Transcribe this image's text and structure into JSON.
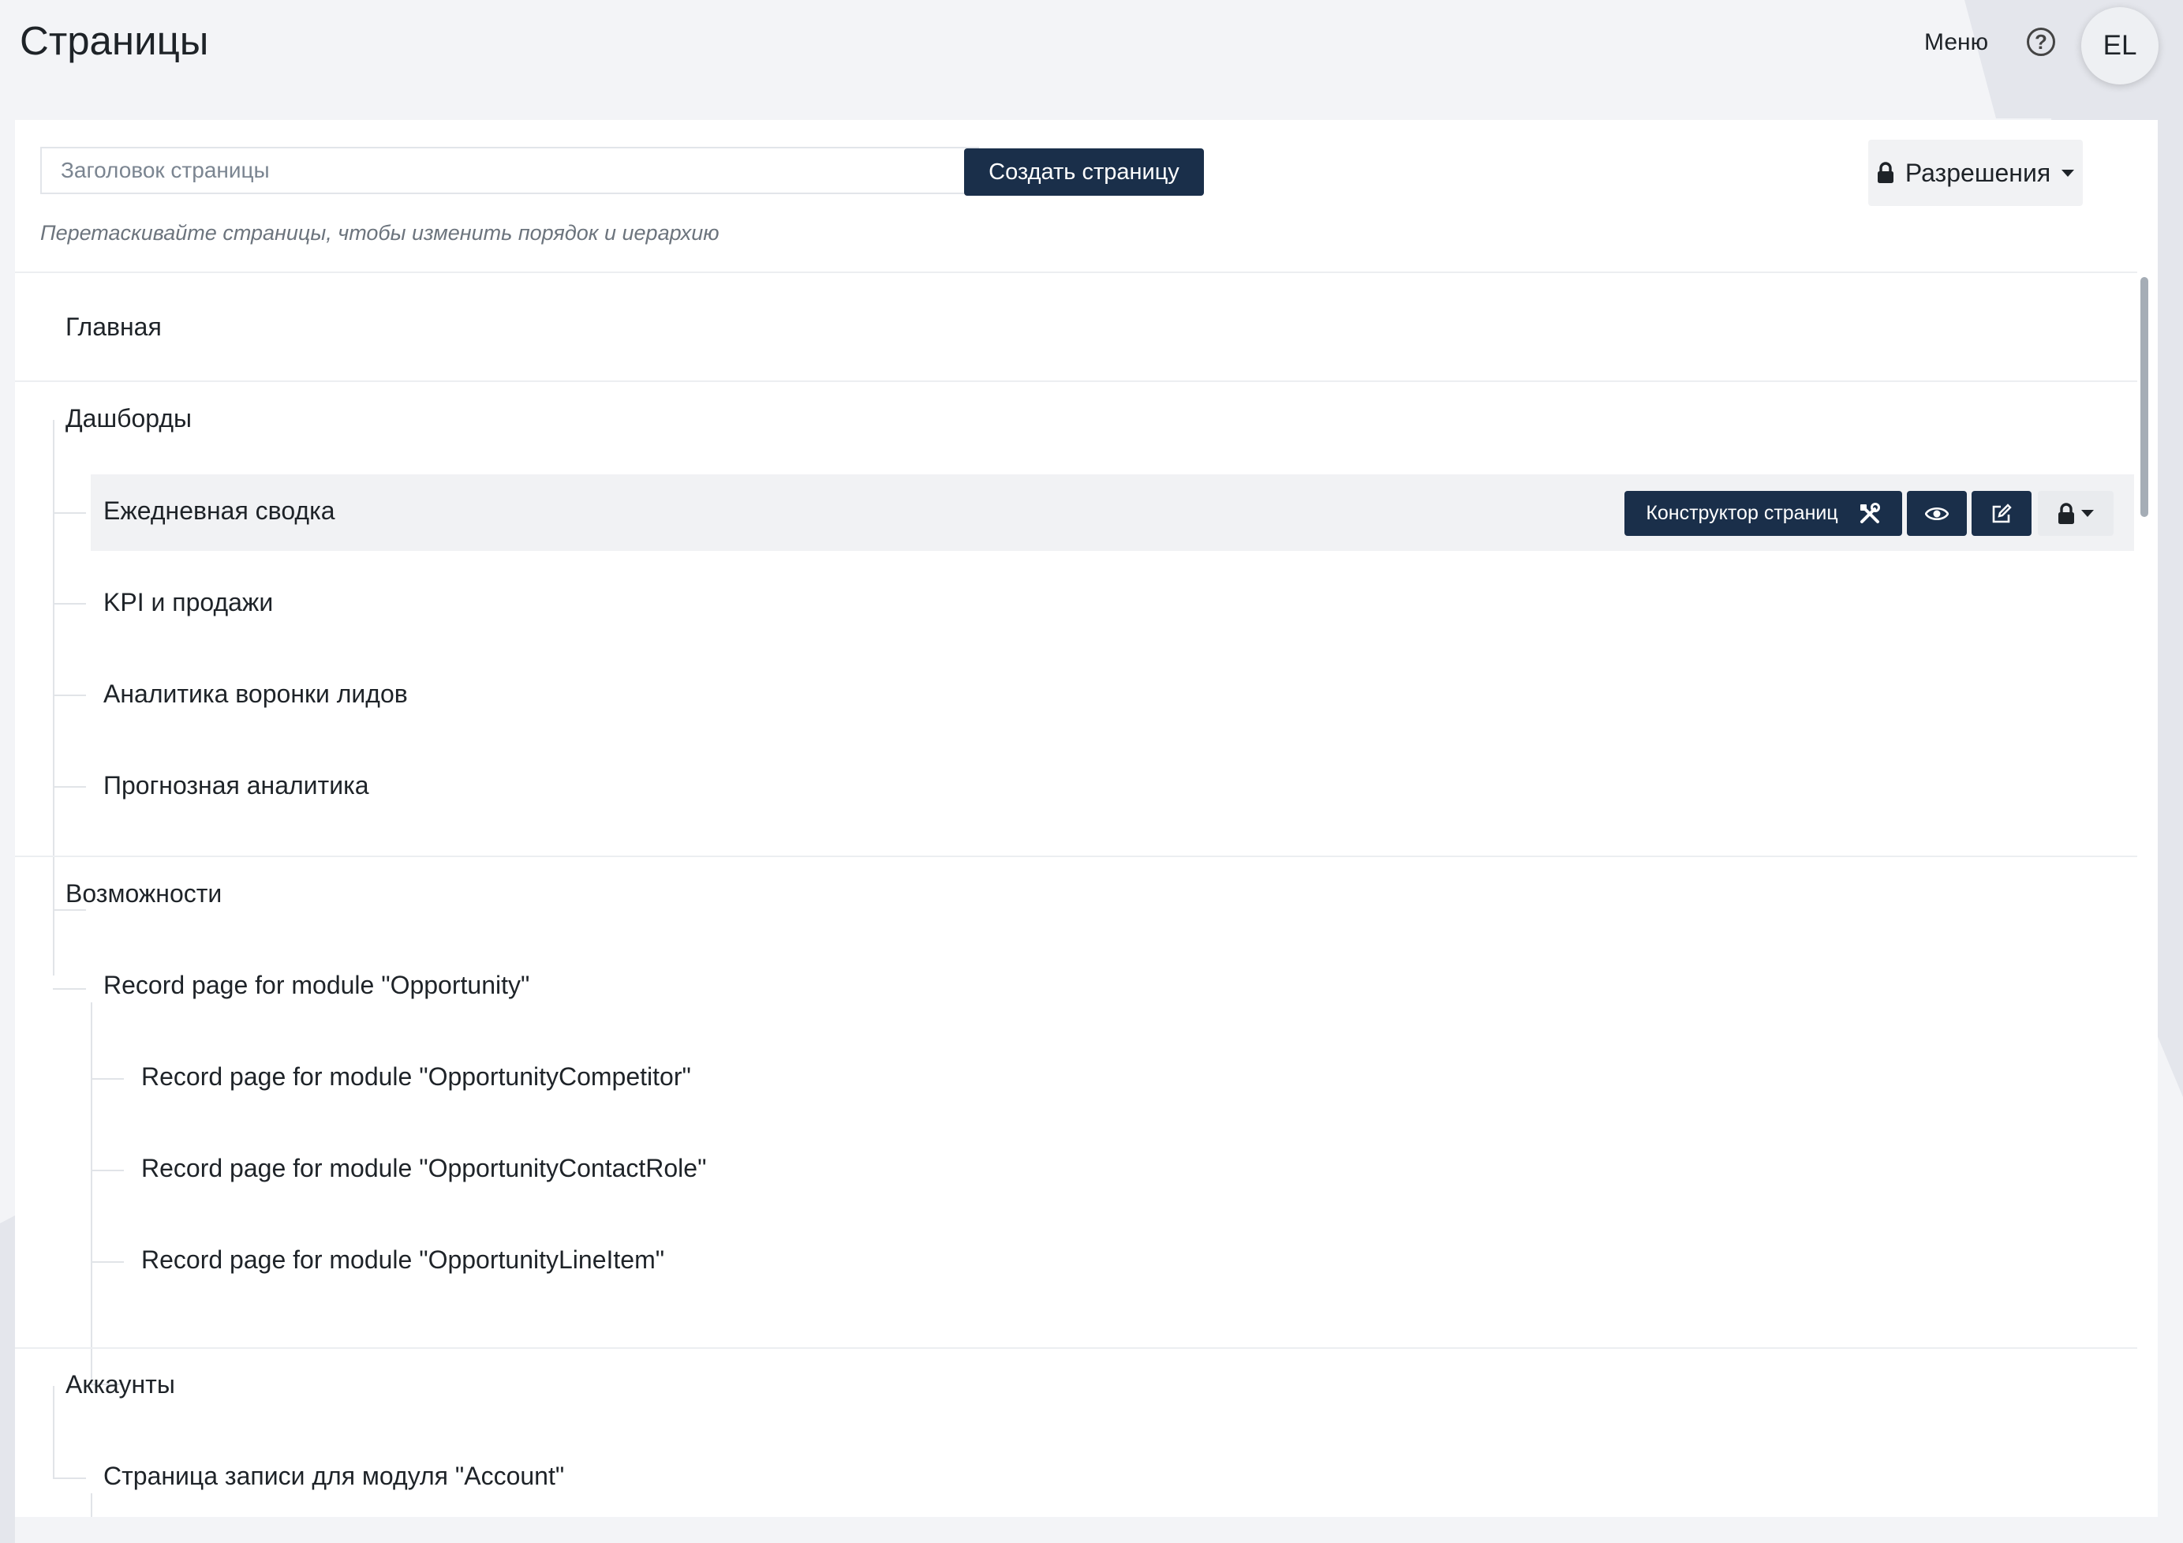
{
  "header": {
    "title": "Страницы",
    "menu_label": "Меню",
    "help_icon": "question-circle-icon",
    "avatar_initials": "EL"
  },
  "toolbar": {
    "title_input_placeholder": "Заголовок страницы",
    "title_input_value": "",
    "create_button_label": "Создать страницу",
    "permissions_button_label": "Разрешения",
    "drag_hint": "Перетаскивайте страницы, чтобы изменить порядок и иерархию"
  },
  "tree": {
    "home": "Главная",
    "dashboards": {
      "label": "Дашборды",
      "children": [
        "Ежедневная сводка",
        "KPI и продажи",
        "Аналитика воронки лидов",
        "Прогнозная аналитика"
      ]
    },
    "features": {
      "label": "Возможности",
      "child": "Record page for module \"Opportunity\"",
      "grandchildren": [
        "Record page for module \"OpportunityCompetitor\"",
        "Record page for module \"OpportunityContactRole\"",
        "Record page for module \"OpportunityLineItem\""
      ]
    },
    "accounts": {
      "label": "Аккаунты",
      "child": "Страница записи для модуля \"Account\""
    }
  },
  "row_actions": {
    "builder_label": "Конструктор страниц",
    "builder_icon": "tools-icon",
    "view_icon": "eye-icon",
    "edit_icon": "edit-icon",
    "lock_icon": "lock-icon"
  },
  "colors": {
    "primary": "#1a2f4a",
    "highlight_row": "#f1f2f4",
    "background": "#f3f4f7"
  }
}
